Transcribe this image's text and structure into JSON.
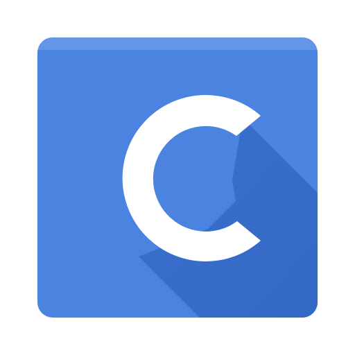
{
  "app_icon": {
    "glyph": "C",
    "icon_name": "letter-c-app-icon",
    "colors": {
      "background": "#ffffff",
      "tile": "#4a84e0",
      "tile_highlight": "#5b90e4",
      "tile_rim": "#7aa6ec",
      "long_shadow": "#2f62bf",
      "glyph": "#ffffff"
    }
  }
}
